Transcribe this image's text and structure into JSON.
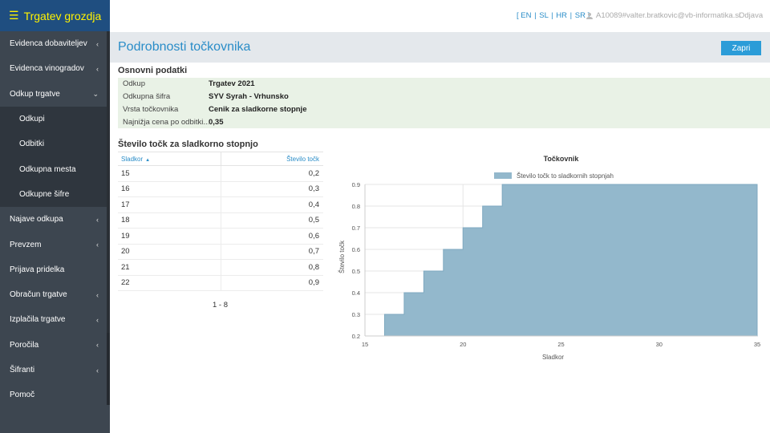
{
  "app": {
    "title": "Trgatev grozdja"
  },
  "menu": [
    {
      "label": "Evidenca dobaviteljev",
      "chev": "‹",
      "type": "main"
    },
    {
      "label": "Evidenca vinogradov",
      "chev": "‹",
      "type": "main"
    },
    {
      "label": "Odkup trgatve",
      "chev": "⌄",
      "type": "open"
    },
    {
      "label": "Odkupi",
      "chev": "",
      "type": "sub"
    },
    {
      "label": "Odbitki",
      "chev": "",
      "type": "sub"
    },
    {
      "label": "Odkupna mesta",
      "chev": "",
      "type": "sub"
    },
    {
      "label": "Odkupne šifre",
      "chev": "",
      "type": "sub"
    },
    {
      "label": "Najave odkupa",
      "chev": "‹",
      "type": "main"
    },
    {
      "label": "Prevzem",
      "chev": "‹",
      "type": "main"
    },
    {
      "label": "Prijava pridelka",
      "chev": "",
      "type": "main"
    },
    {
      "label": "Obračun trgatve",
      "chev": "‹",
      "type": "main"
    },
    {
      "label": "Izplačila trgatve",
      "chev": "‹",
      "type": "main"
    },
    {
      "label": "Poročila",
      "chev": "‹",
      "type": "main"
    },
    {
      "label": "Šifranti",
      "chev": "‹",
      "type": "main"
    },
    {
      "label": "Pomoč",
      "chev": "",
      "type": "main"
    }
  ],
  "top": {
    "lang_open": "[",
    "langs": [
      "EN",
      "SL",
      "HR",
      "SR"
    ],
    "lang_sep": "|",
    "lang_close": "]",
    "user": "A10089#valter.bratkovic@vb-informatika.si",
    "logout": "Odjava"
  },
  "page": {
    "title": "Podrobnosti točkovnika",
    "close_label": "Zapri"
  },
  "basic": {
    "title": "Osnovni podatki",
    "rows": [
      {
        "label": "Odkup",
        "value": "Trgatev 2021"
      },
      {
        "label": "Odkupna šifra",
        "value": "SYV Syrah - Vrhunsko"
      },
      {
        "label": "Vrsta točkovnika",
        "value": "Cenik za sladkorne stopnje"
      },
      {
        "label": "Najnižja cena po odbitki...",
        "value": "0,35"
      }
    ]
  },
  "points": {
    "title": "Število točk za sladkorno stopnjo",
    "col_sugar": "Sladkor",
    "col_points": "Število točk",
    "sort_icon": "▲",
    "rows": [
      {
        "sugar": "15",
        "points": "0,2"
      },
      {
        "sugar": "16",
        "points": "0,3"
      },
      {
        "sugar": "17",
        "points": "0,4"
      },
      {
        "sugar": "18",
        "points": "0,5"
      },
      {
        "sugar": "19",
        "points": "0,6"
      },
      {
        "sugar": "20",
        "points": "0,7"
      },
      {
        "sugar": "21",
        "points": "0,8"
      },
      {
        "sugar": "22",
        "points": "0,9"
      }
    ],
    "pager": "1 - 8"
  },
  "chart_data": {
    "type": "area",
    "step": true,
    "title": "Točkovnik",
    "xlabel": "Sladkor",
    "ylabel": "Število točk",
    "series": [
      {
        "name": "Število točk to sladkornih stopnjah",
        "color": "#93b8cc",
        "x": [
          15,
          16,
          17,
          18,
          19,
          20,
          21,
          22,
          35
        ],
        "y": [
          0.2,
          0.3,
          0.4,
          0.5,
          0.6,
          0.7,
          0.8,
          0.9,
          0.9
        ]
      }
    ],
    "xlim": [
      15,
      35
    ],
    "ylim": [
      0.2,
      0.9
    ],
    "xticks": [
      15,
      20,
      25,
      30,
      35
    ],
    "yticks": [
      0.2,
      0.3,
      0.4,
      0.5,
      0.6,
      0.7,
      0.8,
      0.9
    ],
    "grid": true,
    "legend": "top-center"
  }
}
